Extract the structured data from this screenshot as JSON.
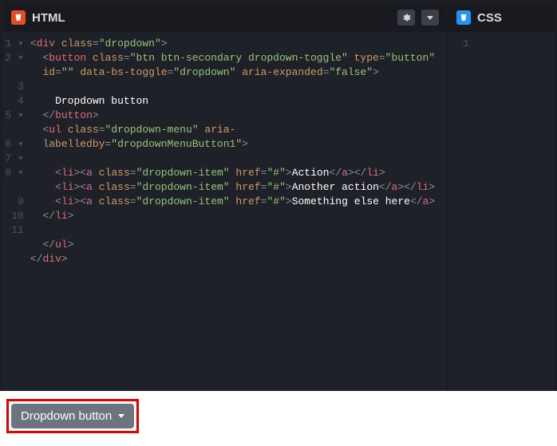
{
  "panels": {
    "html": {
      "title": "HTML"
    },
    "css": {
      "title": "CSS"
    }
  },
  "gutter": {
    "html": [
      "1 ▾",
      "2 ▾",
      "",
      "3",
      "4",
      "5 ▾",
      "",
      "6 ▾",
      "7 ▾",
      "8 ▾",
      "",
      "9",
      "10",
      "11"
    ],
    "css": [
      "1"
    ]
  },
  "code": {
    "div_class": "dropdown",
    "button_class": "btn btn-secondary dropdown-toggle",
    "button_type": "button",
    "button_id": "",
    "button_toggle": "dropdown",
    "button_aria_expanded": "false",
    "button_text": "Dropdown button",
    "ul_class": "dropdown-menu",
    "ul_aria_labelledby": "dropdownMenuButton1",
    "item_class": "dropdown-item",
    "item_href": "#",
    "items": [
      "Action",
      "Another action",
      "Something else here"
    ]
  },
  "output": {
    "button_label": "Dropdown button"
  }
}
